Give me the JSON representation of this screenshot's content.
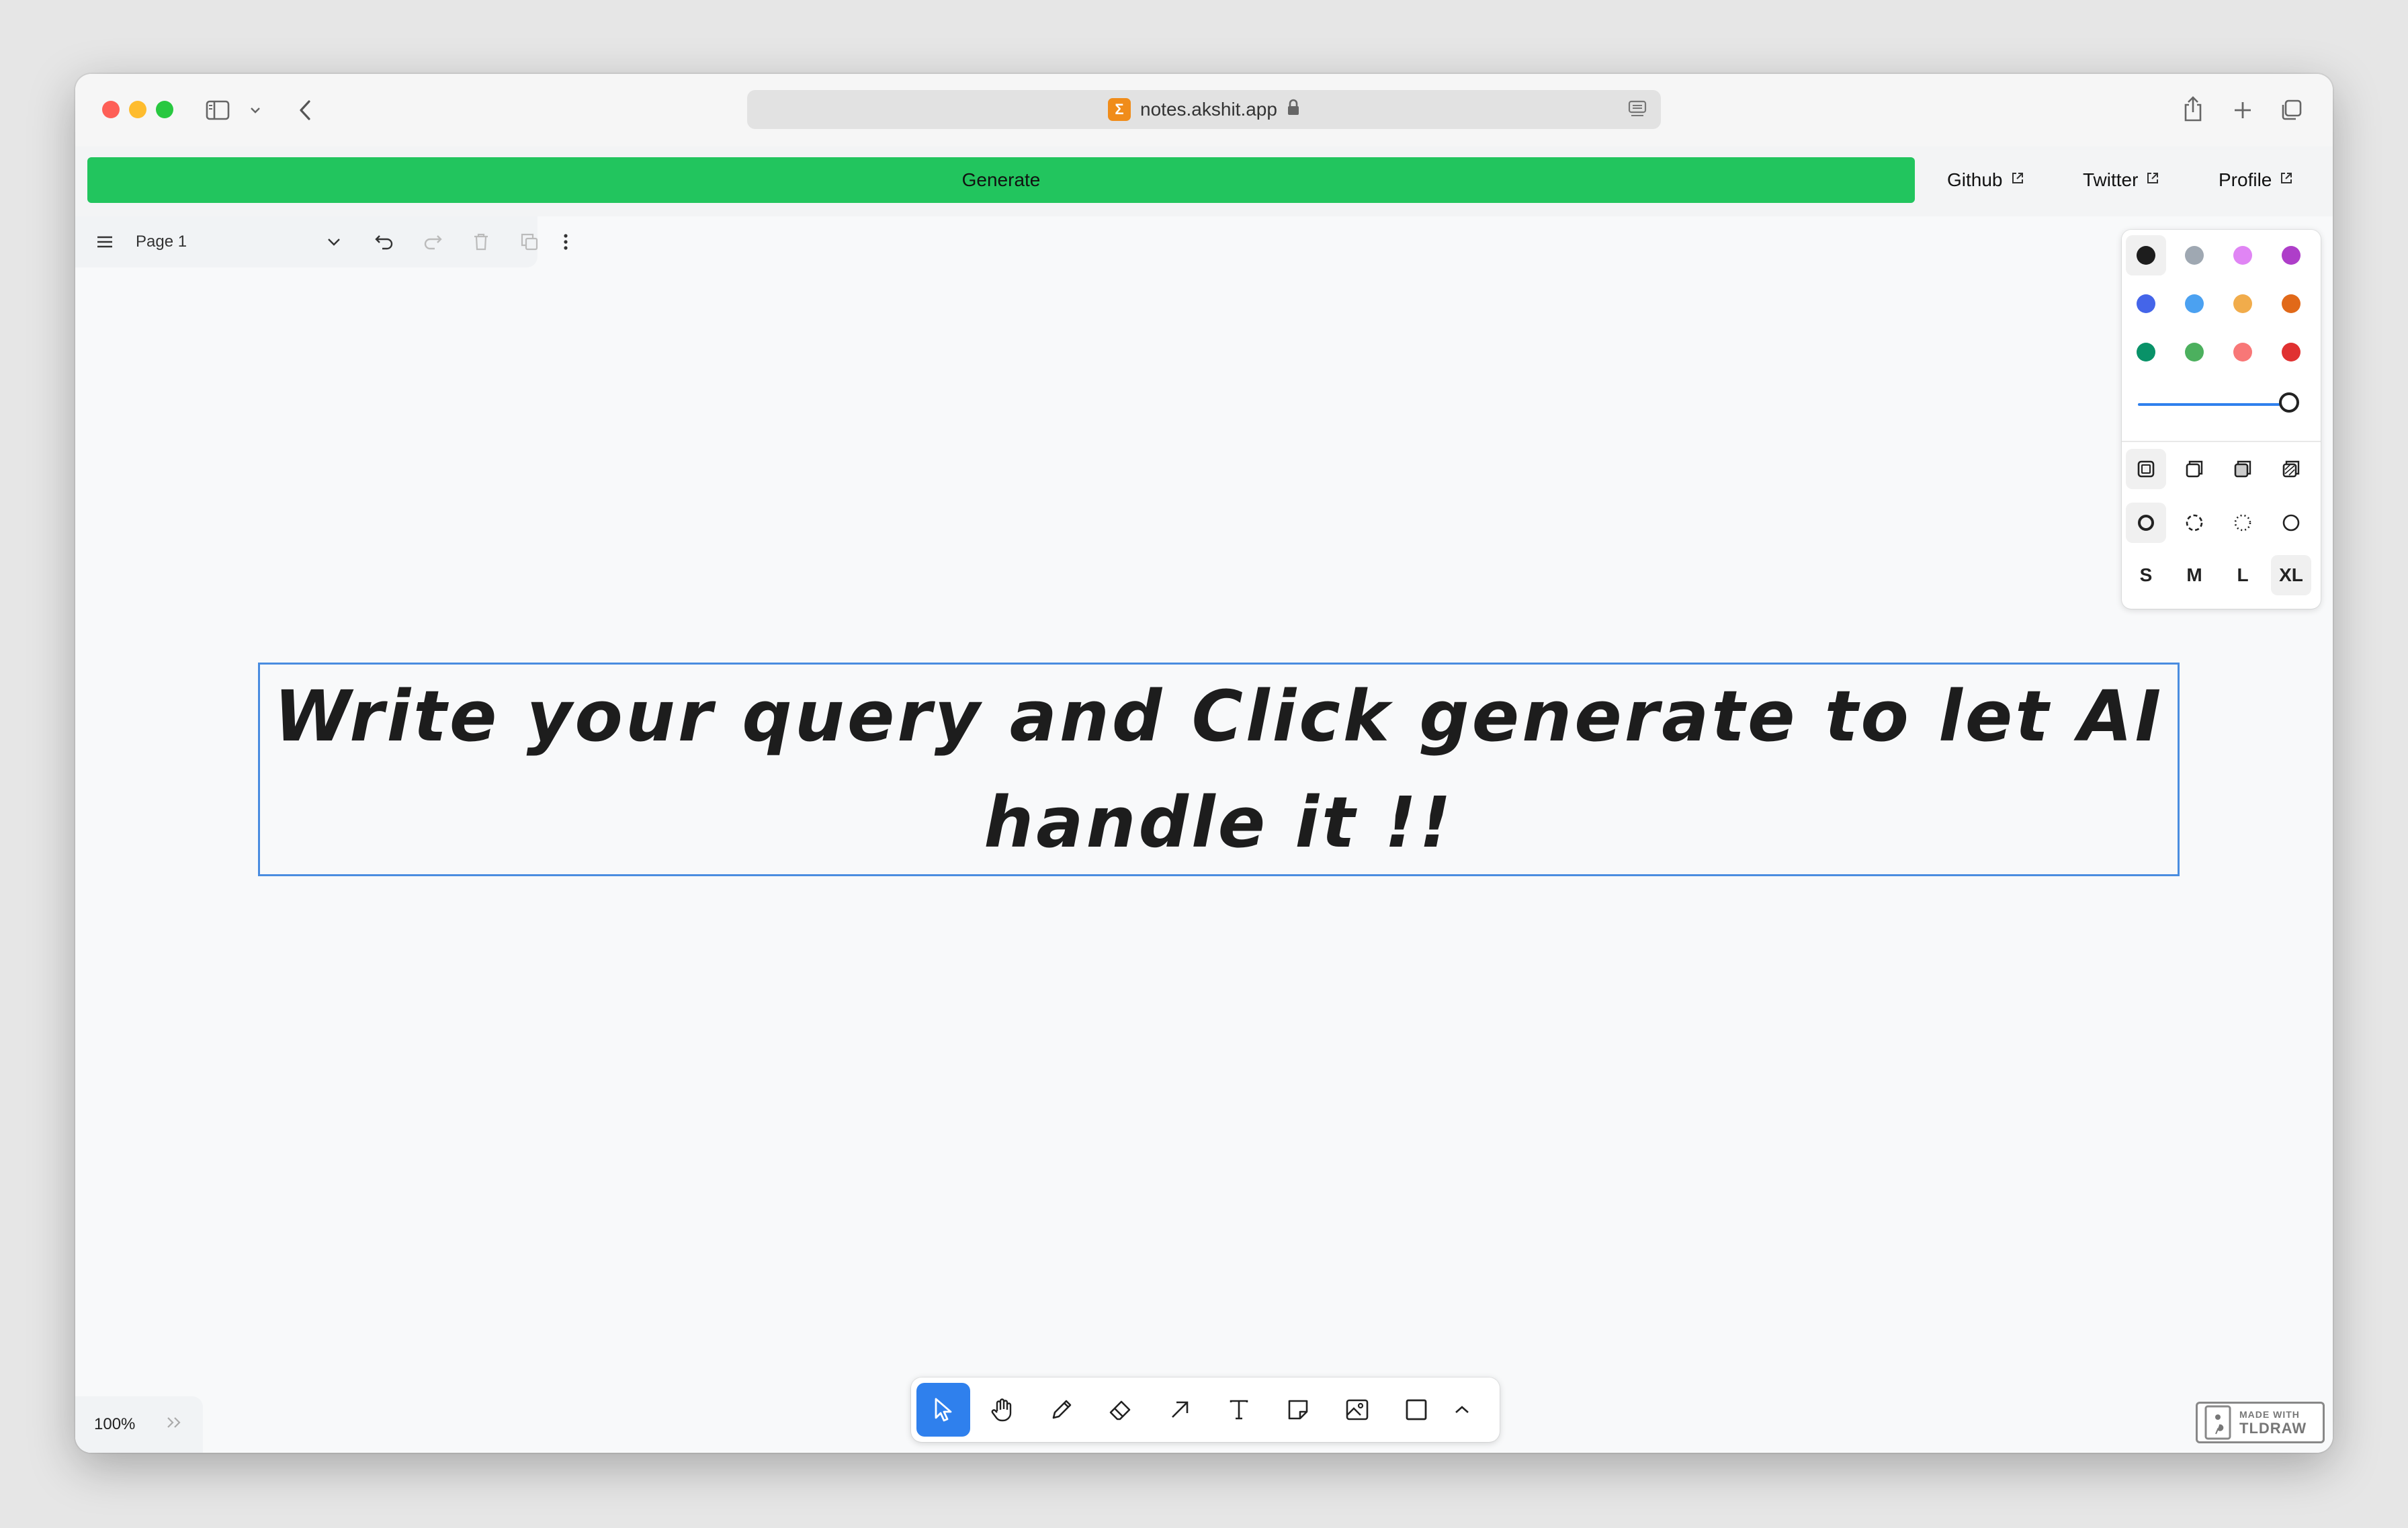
{
  "browser": {
    "url": "notes.akshit.app",
    "favicon_glyph": "Σ"
  },
  "header": {
    "generate_label": "Generate",
    "links": [
      {
        "label": "Github"
      },
      {
        "label": "Twitter"
      },
      {
        "label": "Profile"
      }
    ]
  },
  "page_menu": {
    "page_name": "Page 1"
  },
  "style_panel": {
    "colors": [
      "#1d1d1d",
      "#9fa8b2",
      "#e085f4",
      "#ae3ec9",
      "#4465e9",
      "#4ba1f1",
      "#f1ac4b",
      "#e16919",
      "#099268",
      "#4cb05e",
      "#f87777",
      "#e03131"
    ],
    "selected_color": "#1d1d1d",
    "opacity": 1.0,
    "sizes": [
      "S",
      "M",
      "L",
      "XL"
    ],
    "selected_size": "XL"
  },
  "canvas": {
    "text_shape": "Write your query and Click generate to let AI handle it !!"
  },
  "toolbar": {
    "tools": [
      "select-icon",
      "hand-icon",
      "draw-icon",
      "eraser-icon",
      "arrow-icon",
      "text-icon",
      "note-icon",
      "image-icon",
      "rectangle-icon",
      "chevron-up-icon"
    ],
    "active": "select-icon"
  },
  "zoom": {
    "level": "100%"
  },
  "watermark": {
    "line1": "MADE WITH",
    "line2": "TLDRAW"
  }
}
